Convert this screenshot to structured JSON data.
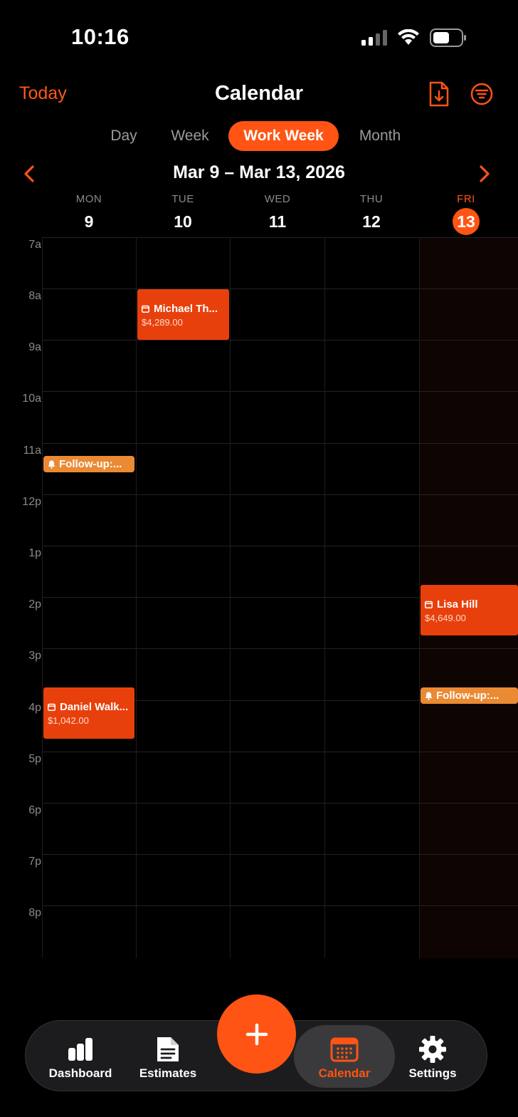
{
  "status_bar": {
    "time": "10:16"
  },
  "header": {
    "today_label": "Today",
    "title": "Calendar",
    "export_icon": "document-download-icon",
    "filter_icon": "filter-icon"
  },
  "view_tabs": [
    {
      "label": "Day",
      "active": false
    },
    {
      "label": "Week",
      "active": false
    },
    {
      "label": "Work Week",
      "active": true
    },
    {
      "label": "Month",
      "active": false
    }
  ],
  "week_nav": {
    "range": "Mar 9 – Mar 13, 2026"
  },
  "days": [
    {
      "dow": "MON",
      "num": "9"
    },
    {
      "dow": "TUE",
      "num": "10"
    },
    {
      "dow": "WED",
      "num": "11"
    },
    {
      "dow": "THU",
      "num": "12"
    },
    {
      "dow": "FRI",
      "num": "13",
      "today": true
    }
  ],
  "hours": [
    "7a",
    "8a",
    "9a",
    "10a",
    "11a",
    "12p",
    "1p",
    "2p",
    "3p",
    "4p",
    "5p",
    "6p",
    "7p",
    "8p"
  ],
  "events": [
    {
      "title": "Michael Th...",
      "amount": "$4,289.00",
      "day": "TUE",
      "start": "8a",
      "end": "9a"
    },
    {
      "title": "Lisa Hill",
      "amount": "$4,649.00",
      "day": "FRI",
      "start": "2p",
      "end": "3p"
    },
    {
      "title": "Daniel Walk...",
      "amount": "$1,042.00",
      "day": "MON",
      "start": "3:30p",
      "end": "4:30p"
    }
  ],
  "reminders": [
    {
      "title": "Follow-up:...",
      "day": "MON",
      "time": "11:15a"
    },
    {
      "title": "Follow-up:...",
      "day": "FRI",
      "time": "3:45p"
    }
  ],
  "tabbar": {
    "dashboard": "Dashboard",
    "estimates": "Estimates",
    "calendar": "Calendar",
    "settings": "Settings",
    "add_icon": "plus-icon"
  },
  "colors": {
    "accent": "#ff5414",
    "event": "#e8400c",
    "reminder": "#ea8a34",
    "background": "#000000"
  }
}
